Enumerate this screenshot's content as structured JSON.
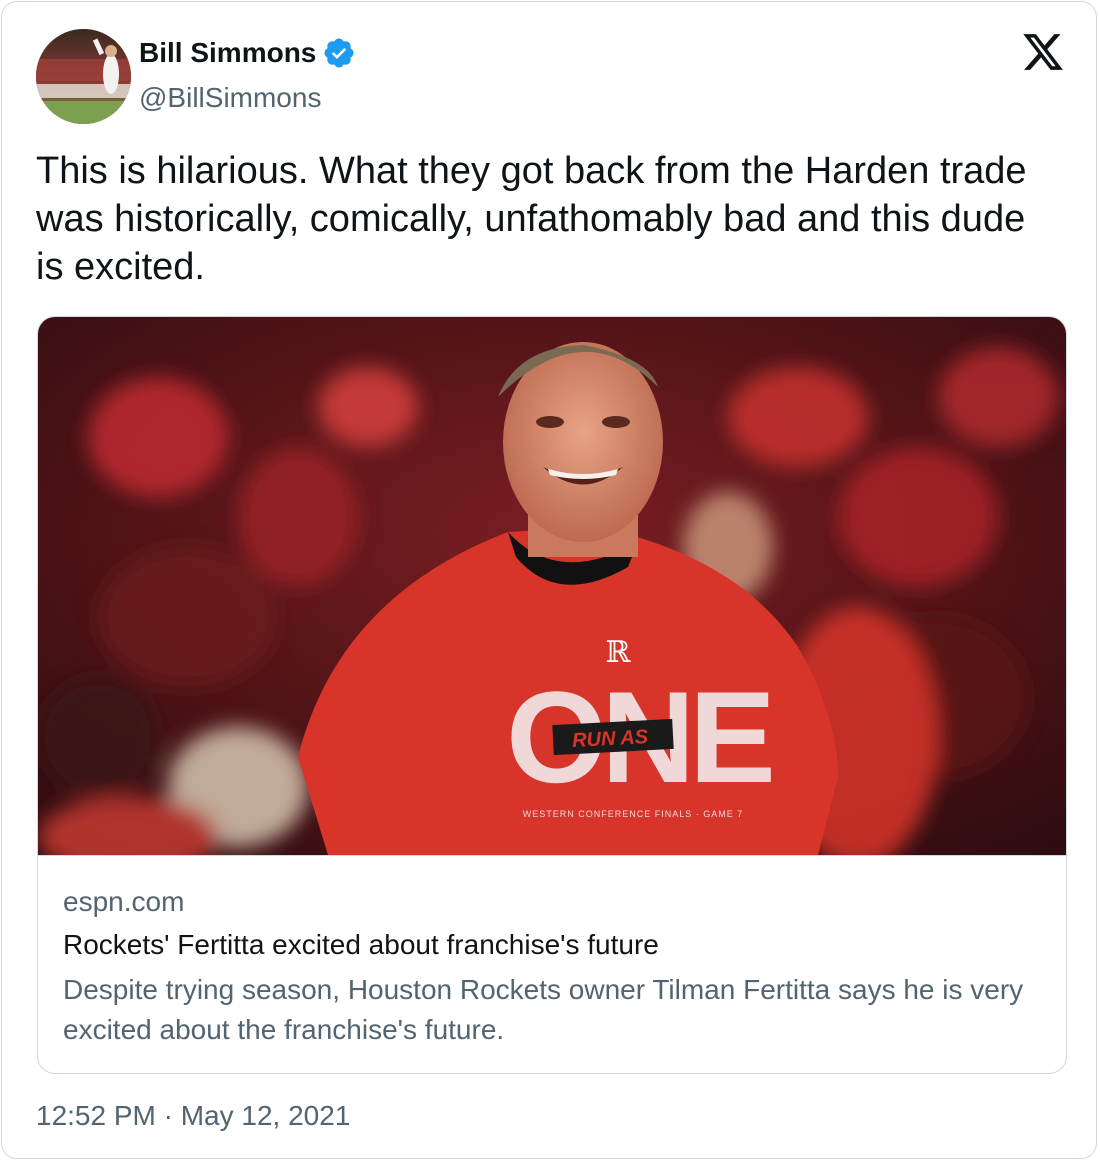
{
  "author": {
    "display_name": "Bill Simmons",
    "handle": "@BillSimmons",
    "verified": true
  },
  "icons": {
    "avatar": "profile-photo",
    "verified": "verified-badge-icon",
    "platform": "x-logo-icon"
  },
  "tweet": {
    "text": "This is hilarious. What they got back from the Harden trade was historically, comically, unfathomably bad and this dude is excited."
  },
  "link_card": {
    "domain": "espn.com",
    "title": "Rockets' Fertitta excited about franchise's future",
    "description": "Despite trying season, Houston Rockets owner Tilman Fertitta says he is very excited about the franchise's future.",
    "image_shirt_text": "ONE",
    "image_shirt_tag": "RUN AS",
    "image_shirt_caption": "WESTERN CONFERENCE FINALS · GAME 7"
  },
  "meta": {
    "timestamp": "12:52 PM · May 12, 2021"
  },
  "colors": {
    "text_primary": "#0f1419",
    "text_secondary": "#536471",
    "border": "#cfd9de",
    "verified_blue": "#1d9bf0",
    "shirt_red": "#d8352a"
  }
}
